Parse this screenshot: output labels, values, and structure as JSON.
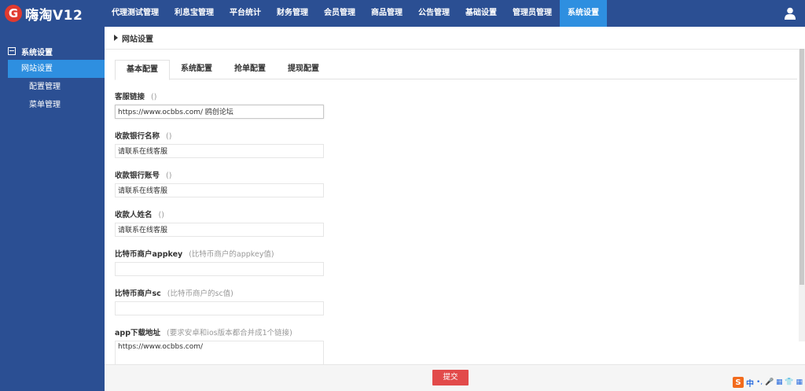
{
  "app": {
    "logo_letter": "G",
    "title": "嗨淘V12"
  },
  "nav": {
    "items": [
      "代理测试管理",
      "利息宝管理",
      "平台统计",
      "财务管理",
      "会员管理",
      "商品管理",
      "公告管理",
      "基础设置",
      "管理员管理",
      "系统设置"
    ],
    "active_index": 9
  },
  "sidebar": {
    "group": "系统设置",
    "items": [
      "网站设置",
      "配置管理",
      "菜单管理"
    ],
    "active_index": 0
  },
  "breadcrumb": "网站设置",
  "tabs": [
    "基本配置",
    "系统配置",
    "抢单配置",
    "提现配置"
  ],
  "form": {
    "fields": [
      {
        "label": "客服链接",
        "hint": "()",
        "value": "https://www.ocbbs.com/ 鸥创论坛"
      },
      {
        "label": "收款银行名称",
        "hint": "()",
        "value": "请联系在线客服"
      },
      {
        "label": "收款银行账号",
        "hint": "()",
        "value": "请联系在线客服"
      },
      {
        "label": "收款人姓名",
        "hint": "()",
        "value": "请联系在线客服"
      },
      {
        "label": "比特币商户appkey",
        "hint": "(比特币商户的appkey值)",
        "value": ""
      },
      {
        "label": "比特币商户sc",
        "hint": "(比特币商户的sc值)",
        "value": ""
      },
      {
        "label": "app下载地址",
        "hint": "(要求安卓和ios版本都合并成1个链接)",
        "value": "https://www.ocbbs.com/"
      }
    ]
  },
  "submit_label": "提交",
  "ime": {
    "logo": "S",
    "mode": "中",
    "glyphs": "•, 🎤 ▦ 👕 ▦"
  },
  "colors": {
    "nav_bg": "#2b4f93",
    "active": "#2e8fe0",
    "submit": "#e24a4a",
    "logo": "#e03a2f"
  }
}
